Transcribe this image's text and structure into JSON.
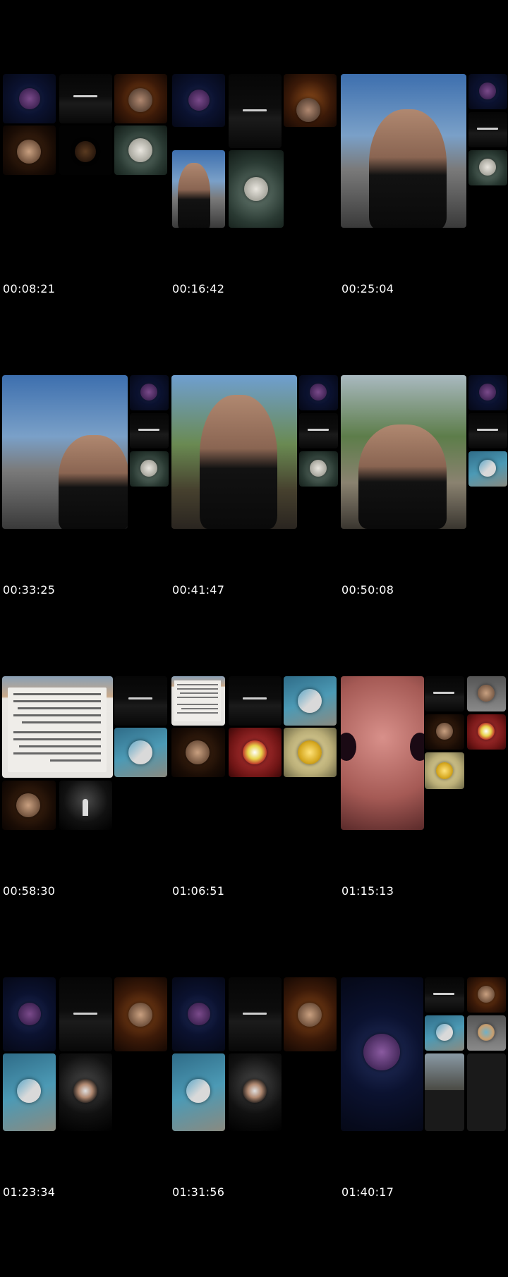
{
  "thumbnails": [
    {
      "timestamp": "00:08:21"
    },
    {
      "timestamp": "00:16:42"
    },
    {
      "timestamp": "00:25:04"
    },
    {
      "timestamp": "00:33:25"
    },
    {
      "timestamp": "00:41:47"
    },
    {
      "timestamp": "00:50:08"
    },
    {
      "timestamp": "00:58:30"
    },
    {
      "timestamp": "01:06:51"
    },
    {
      "timestamp": "01:15:13"
    },
    {
      "timestamp": "01:23:34"
    },
    {
      "timestamp": "01:31:56"
    },
    {
      "timestamp": "01:40:17"
    }
  ]
}
